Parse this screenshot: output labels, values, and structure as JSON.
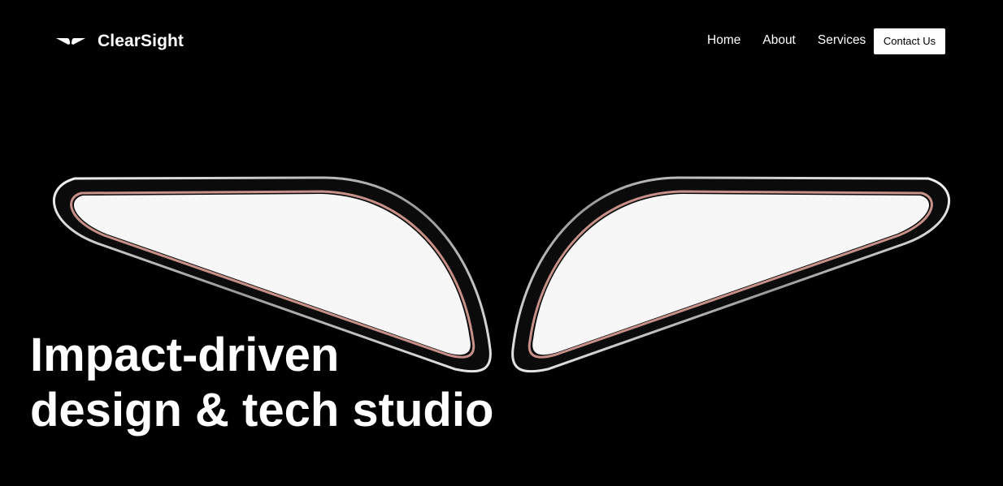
{
  "brand": {
    "name": "ClearSight",
    "logo_icon": "wing-logo-icon"
  },
  "nav": {
    "links": [
      {
        "label": "Home"
      },
      {
        "label": "About"
      },
      {
        "label": "Services"
      }
    ],
    "contact_label": "Contact Us"
  },
  "hero": {
    "heading_line1": "Impact-driven",
    "heading_line2": "design & tech studio",
    "art_icon": "wing-shapes-illustration"
  },
  "colors": {
    "background": "#000000",
    "text": "#ffffff",
    "button_bg": "#ffffff",
    "button_text": "#000000",
    "wing_glow": "#e9a9a0"
  }
}
